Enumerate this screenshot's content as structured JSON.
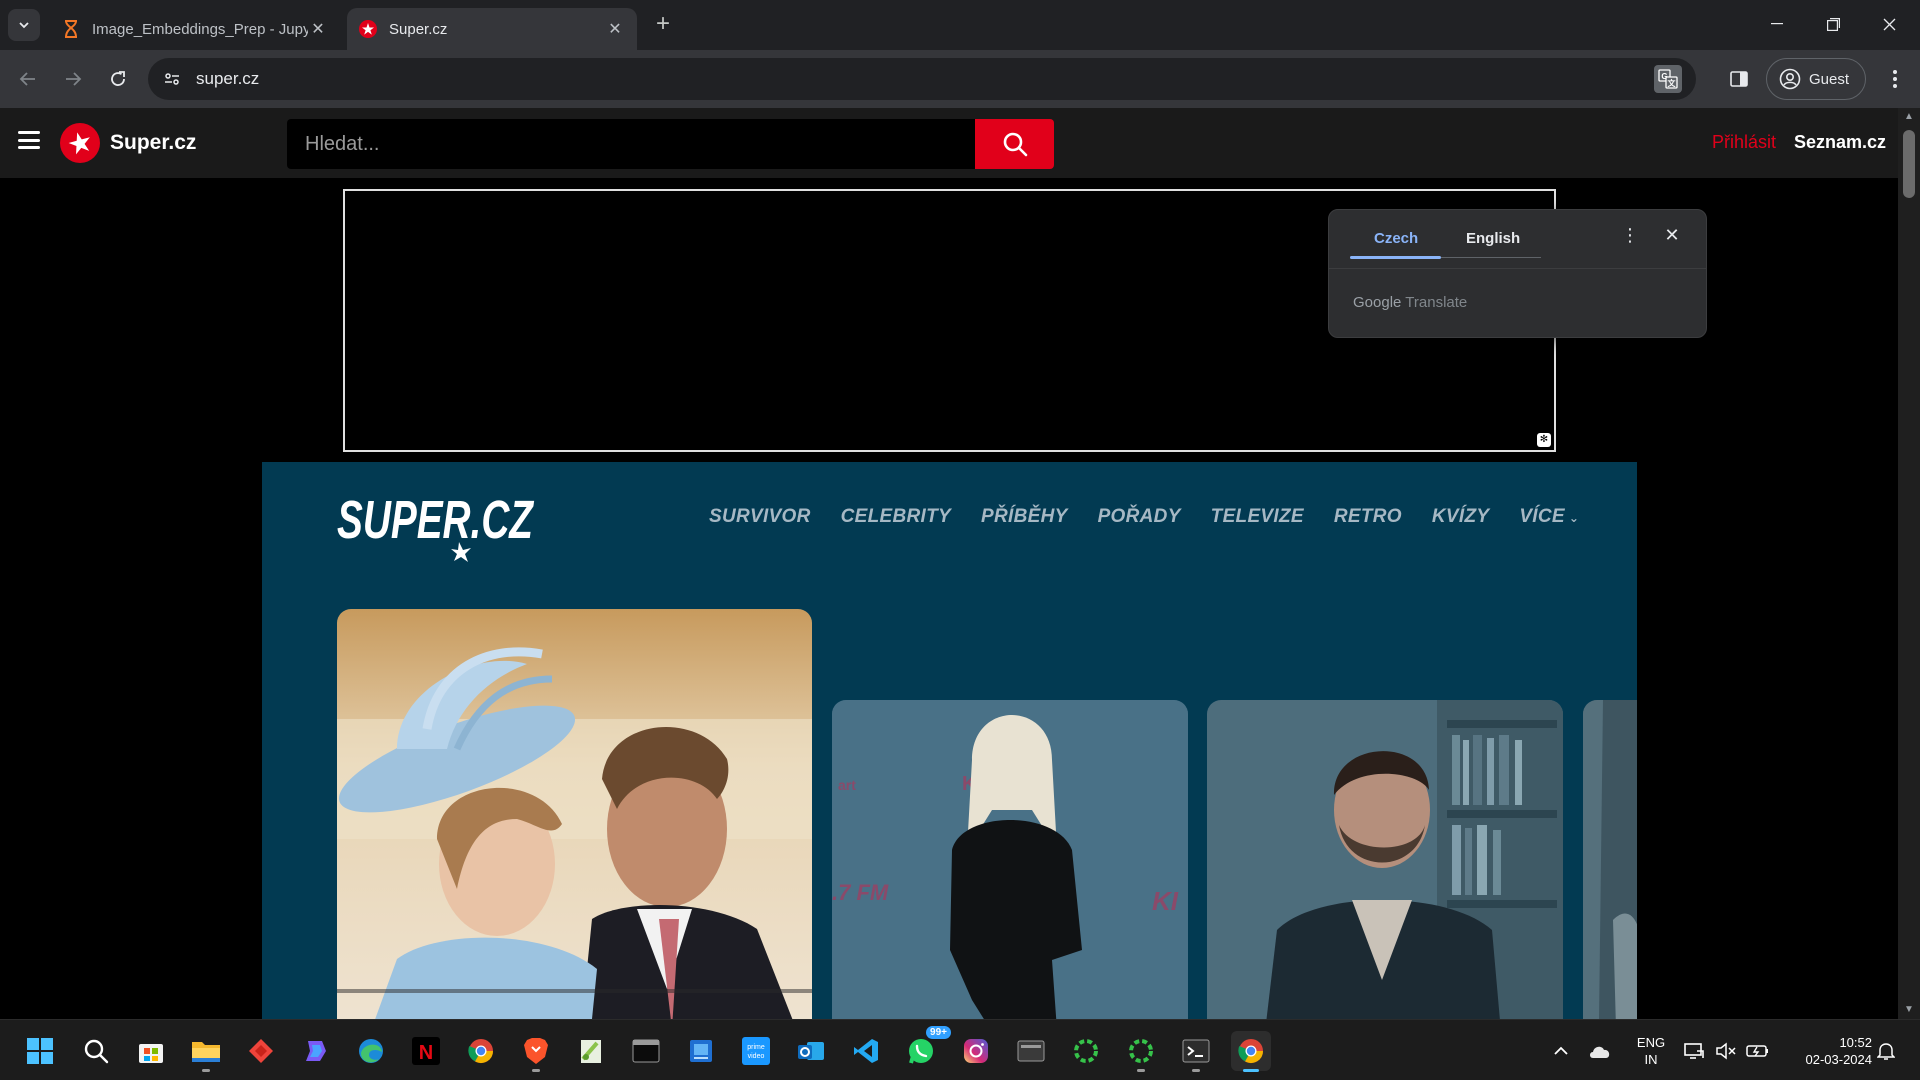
{
  "browser": {
    "tabs": [
      {
        "title": "Image_Embeddings_Prep - Jupy",
        "active": false
      },
      {
        "title": "Super.cz",
        "active": true
      }
    ],
    "url": "super.cz",
    "profile_label": "Guest"
  },
  "site": {
    "logo_text": "Super.cz",
    "search_placeholder": "Hledat...",
    "login_label": "Přihlásit",
    "seznam_label": "Seznam.cz",
    "brand_wordmark": "SUPER.CZ",
    "nav": [
      "SURVIVOR",
      "CELEBRITY",
      "PŘÍBĚHY",
      "POŘADY",
      "TELEVIZE",
      "RETRO",
      "KVÍZY",
      "VÍCE"
    ],
    "colors": {
      "brand_red": "#e1001a",
      "section_bg": "#023a52",
      "nav_text": "#a6b8c4"
    }
  },
  "translate_popup": {
    "source_lang": "Czech",
    "target_lang": "English",
    "footer_google": "Google",
    "footer_translate": "Translate"
  },
  "taskbar": {
    "apps": [
      "windows-start",
      "search",
      "microsoft-store",
      "file-explorer",
      "anydesk",
      "copilot",
      "edge",
      "netflix",
      "chrome",
      "brave",
      "notepad-plus",
      "terminal",
      "windows-sandbox",
      "prime-video",
      "outlook",
      "vscode",
      "whatsapp",
      "instagram",
      "app-window",
      "arc-loader",
      "arc-loader-2",
      "powershell",
      "chrome-active"
    ],
    "whatsapp_badge": "99+",
    "lang_line1": "ENG",
    "lang_line2": "IN",
    "time": "10:52",
    "date": "02-03-2024"
  }
}
